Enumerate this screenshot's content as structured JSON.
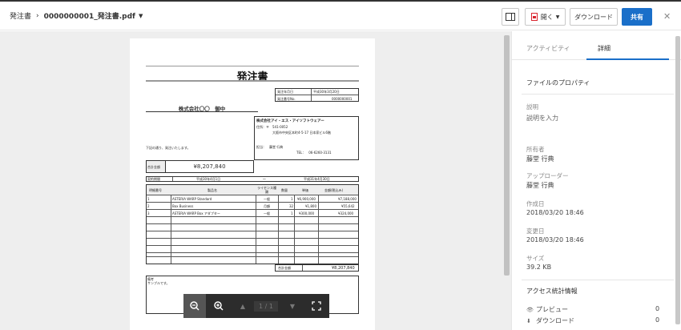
{
  "header": {
    "folder": "発注書",
    "filename": "0000000001_発注書.pdf",
    "open_label": "開く",
    "download_label": "ダウンロード",
    "share_label": "共有"
  },
  "document": {
    "title": "発注書",
    "order_date_label": "発注年月日",
    "order_date": "平成30年3月20日",
    "order_no_label": "発注番号No.",
    "order_no": "0000000001",
    "customer": "株式会社〇〇　御中",
    "supplier": "株式会社アイ・エス・アイソフトウェアー",
    "postal": "住所：〒　541-0052",
    "address": "大阪市中央区本町4-5-17 日本家ビル6階",
    "contact": "担当：　藤堂 行典",
    "tel": "TEL：　06-6260-3131",
    "note": "下記の通り、発注いたします。",
    "total_label": "合計金額",
    "total": "¥8,207,840",
    "period_label": "契約期間",
    "period_from": "平成30年4月1日",
    "period_dash": "～",
    "period_to": "平成31年4月30日",
    "columns": [
      "明細番号",
      "製品名",
      "ライセンス種類",
      "数量",
      "単価",
      "金額(税込み)"
    ],
    "rows": [
      [
        "1",
        "ASTERIA WARP Standard",
        "一般",
        "1",
        "¥6,900,000",
        "¥7,188,000"
      ],
      [
        "2",
        "Box Business",
        "月額",
        "32",
        "¥1,800",
        "¥55,642"
      ],
      [
        "3",
        "ASTERIA WARP Box アダプター",
        "一般",
        "1",
        "¥300,000",
        "¥324,000"
      ]
    ],
    "grand_total_label": "合計金額",
    "grand_total": "¥8,207,840",
    "remarks_label": "備考",
    "remarks": "サンプルです。"
  },
  "viewer_toolbar": {
    "page_indicator": "1 / 1"
  },
  "sidebar": {
    "tab_activity": "アクティビティ",
    "tab_details": "詳細",
    "section_props": "ファイルのプロパティ",
    "desc_label": "説明",
    "desc_value": "説明を入力",
    "owner_label": "所有者",
    "owner_value": "藤堂 行典",
    "uploader_label": "アップローダー",
    "uploader_value": "藤堂 行典",
    "created_label": "作成日",
    "created_value": "2018/03/20 18:46",
    "modified_label": "変更日",
    "modified_value": "2018/03/20 18:46",
    "size_label": "サイズ",
    "size_value": "39.2 KB",
    "section_stats": "アクセス統計情報",
    "stats": [
      {
        "label": "プレビュー",
        "value": "0",
        "icon": "eye-icon"
      },
      {
        "label": "ダウンロード",
        "value": "0",
        "icon": "download-icon"
      }
    ]
  }
}
